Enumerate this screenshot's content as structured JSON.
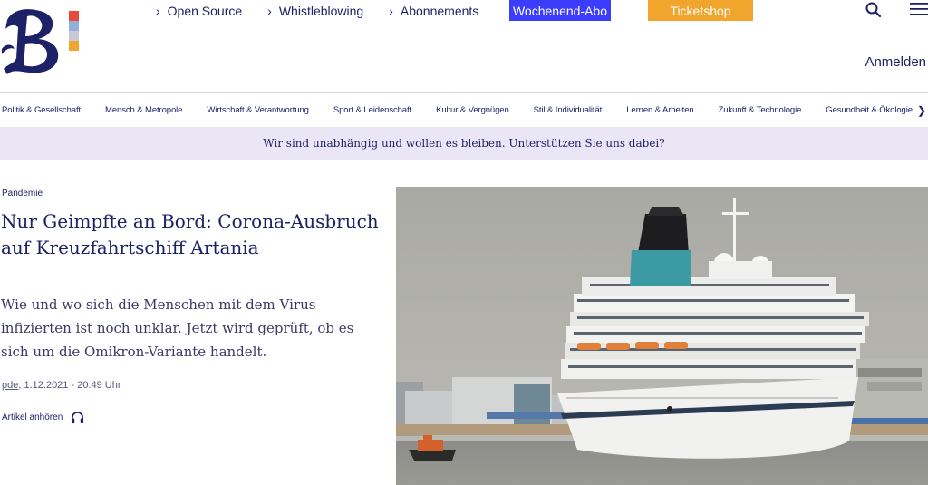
{
  "topnav": {
    "links": [
      "Open Source",
      "Whistleblowing",
      "Abonnements"
    ],
    "abo_button": "Wochenend-Abo",
    "ticket_button": "Ticketshop",
    "login": "Anmelden"
  },
  "categories": [
    "Politik & Gesellschaft",
    "Mensch & Metropole",
    "Wirtschaft & Verantwortung",
    "Sport & Leidenschaft",
    "Kultur & Vergnügen",
    "Stil & Individualität",
    "Lernen & Arbeiten",
    "Zukunft & Technologie",
    "Gesundheit & Ökologie"
  ],
  "banner": "Wir sind unabhängig und wollen es bleiben. Unterstützen Sie uns dabei?",
  "article": {
    "kicker": "Pandemie",
    "headline": "Nur Geimpfte an Bord: Corona-Ausbruch auf Kreuzfahrtschiff Artania",
    "teaser": "Wie und wo sich die Menschen mit dem Virus infizierten ist noch unklar. Jetzt wird geprüft, ob es sich um die Omikron-Variante handelt.",
    "author": "pde",
    "date": "1.12.2021 - 20:49 Uhr",
    "listen_label": "Artikel anhören"
  },
  "colors": {
    "brand": "#1d2267",
    "abo_button": "#3c3cff",
    "ticket_button": "#f2a52c",
    "banner_bg": "#ebe6f6"
  },
  "icons": [
    "logo-b-icon",
    "chevron-right-icon",
    "search-icon",
    "menu-icon",
    "headphones-icon"
  ]
}
